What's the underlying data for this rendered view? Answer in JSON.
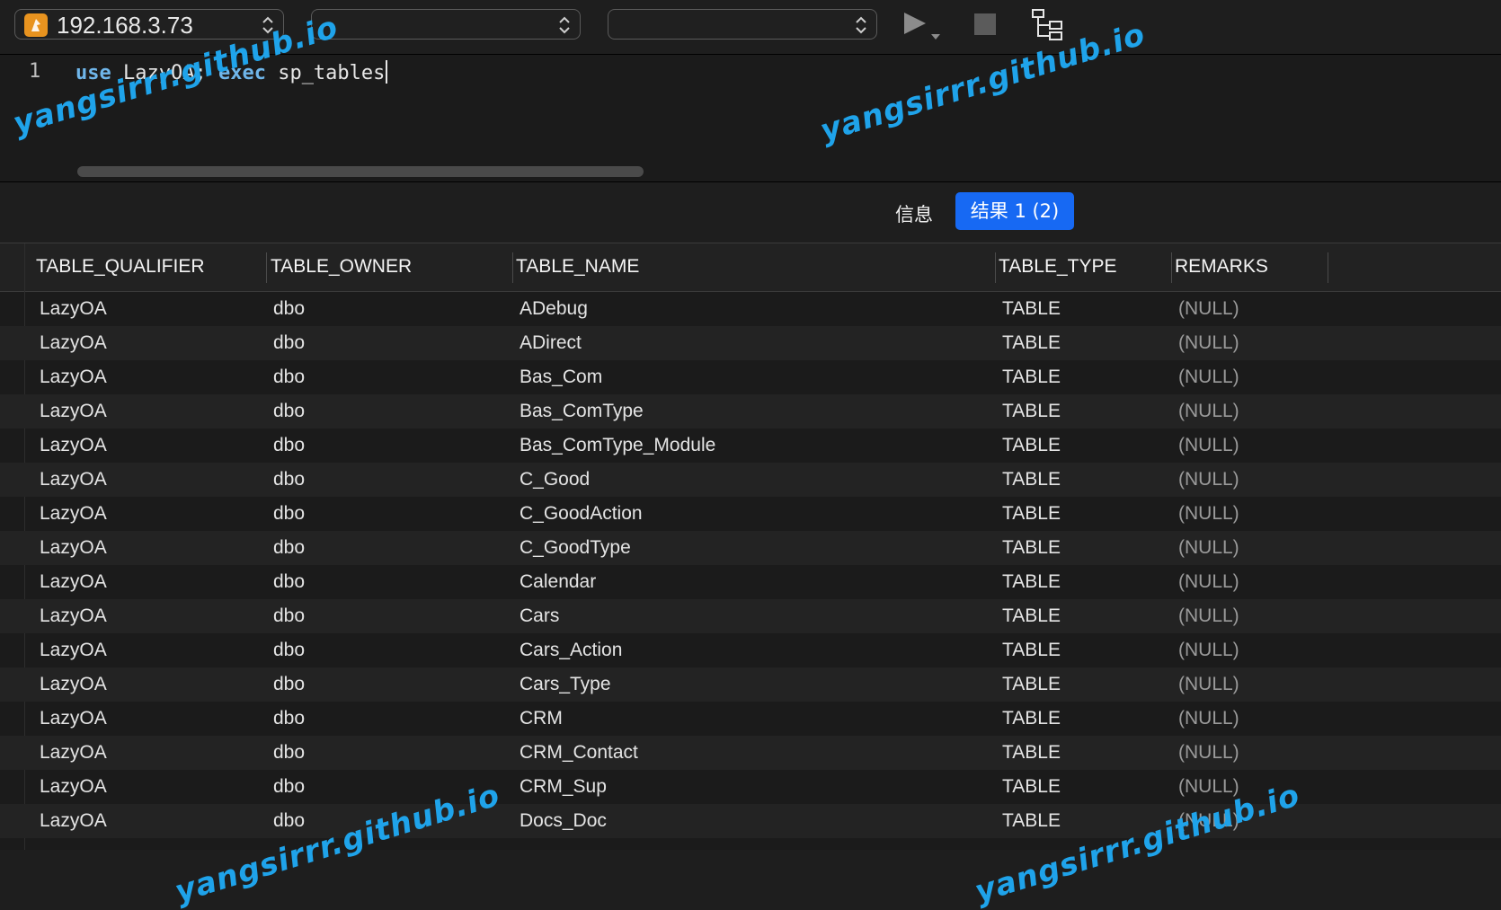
{
  "toolbar": {
    "connection": "192.168.3.73",
    "database": "",
    "schema": ""
  },
  "editor": {
    "line_number": "1",
    "code_kw1": "use",
    "code_part1": " LazyOA; ",
    "code_kw2": "exec",
    "code_part2": " sp_tables"
  },
  "result_tabs": {
    "info_label": "信息",
    "result_label": "结果 1 (2)"
  },
  "grid": {
    "columns": [
      "TABLE_QUALIFIER",
      "TABLE_OWNER",
      "TABLE_NAME",
      "TABLE_TYPE",
      "REMARKS"
    ],
    "rows": [
      [
        "LazyOA",
        "dbo",
        "ADebug",
        "TABLE",
        "(NULL)"
      ],
      [
        "LazyOA",
        "dbo",
        "ADirect",
        "TABLE",
        "(NULL)"
      ],
      [
        "LazyOA",
        "dbo",
        "Bas_Com",
        "TABLE",
        "(NULL)"
      ],
      [
        "LazyOA",
        "dbo",
        "Bas_ComType",
        "TABLE",
        "(NULL)"
      ],
      [
        "LazyOA",
        "dbo",
        "Bas_ComType_Module",
        "TABLE",
        "(NULL)"
      ],
      [
        "LazyOA",
        "dbo",
        "C_Good",
        "TABLE",
        "(NULL)"
      ],
      [
        "LazyOA",
        "dbo",
        "C_GoodAction",
        "TABLE",
        "(NULL)"
      ],
      [
        "LazyOA",
        "dbo",
        "C_GoodType",
        "TABLE",
        "(NULL)"
      ],
      [
        "LazyOA",
        "dbo",
        "Calendar",
        "TABLE",
        "(NULL)"
      ],
      [
        "LazyOA",
        "dbo",
        "Cars",
        "TABLE",
        "(NULL)"
      ],
      [
        "LazyOA",
        "dbo",
        "Cars_Action",
        "TABLE",
        "(NULL)"
      ],
      [
        "LazyOA",
        "dbo",
        "Cars_Type",
        "TABLE",
        "(NULL)"
      ],
      [
        "LazyOA",
        "dbo",
        "CRM",
        "TABLE",
        "(NULL)"
      ],
      [
        "LazyOA",
        "dbo",
        "CRM_Contact",
        "TABLE",
        "(NULL)"
      ],
      [
        "LazyOA",
        "dbo",
        "CRM_Sup",
        "TABLE",
        "(NULL)"
      ],
      [
        "LazyOA",
        "dbo",
        "Docs_Doc",
        "TABLE",
        "(NULL)"
      ]
    ]
  },
  "watermark": "yangsirrr.github.io",
  "colors": {
    "accent": "#1769f3",
    "keyword": "#6fb6ea",
    "watermark": "#1fa3ea",
    "db_icon": "#e8931f"
  },
  "icons": [
    "database-icon",
    "stepper-icon",
    "run-icon",
    "stop-icon",
    "explain-icon"
  ]
}
